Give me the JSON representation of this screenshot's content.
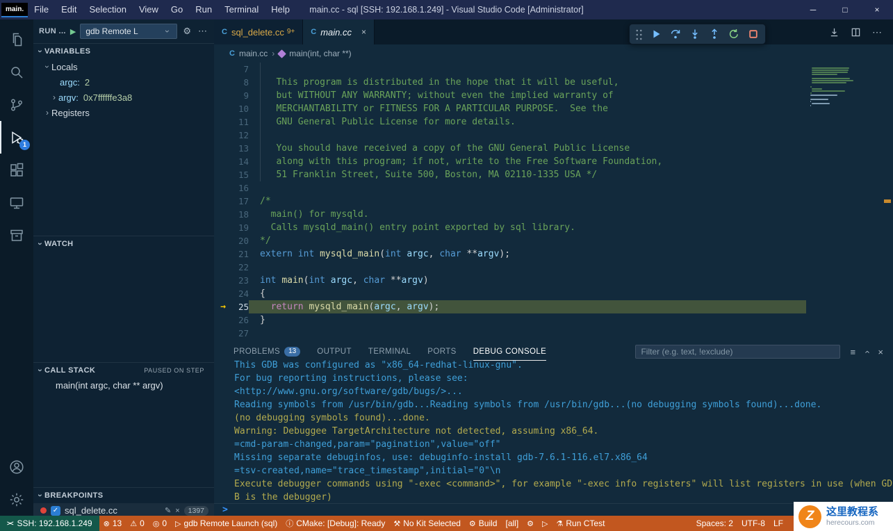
{
  "glyphs": {
    "chevron": "›",
    "close": "×",
    "ellipsis": "⋯",
    "gear": "⚙",
    "play": "▶",
    "edit": "✎",
    "check": "✓",
    "minimize": "─",
    "maximize": "□",
    "window_close": "×",
    "breadcrumb_sep": "›",
    "remote": "><",
    "prompt": ">",
    "ip_arrow": "→",
    "file_c": "C",
    "menu_lines": "≡"
  },
  "title_bar": {
    "app_badge": "main.",
    "menus": [
      "File",
      "Edit",
      "Selection",
      "View",
      "Go",
      "Run",
      "Terminal",
      "Help"
    ],
    "title": "main.cc - sql [SSH: 192.168.1.249] - Visual Studio Code [Administrator]"
  },
  "activity_bar": {
    "debug_badge": "1"
  },
  "sidebar": {
    "run_label": "RUN ...",
    "launch_config": "gdb Remote L",
    "variables": {
      "title": "VARIABLES",
      "scope_label": "Locals",
      "vars": [
        {
          "name": "argc:",
          "value": "2"
        },
        {
          "name": "argv:",
          "value": "0x7ffffffe3a8"
        }
      ],
      "registers_label": "Registers"
    },
    "watch": {
      "title": "WATCH"
    },
    "call_stack": {
      "title": "CALL STACK",
      "status": "PAUSED ON STEP",
      "frame": "main(int argc, char ** argv)"
    },
    "breakpoints": {
      "title": "BREAKPOINTS",
      "file": "sql_delete.cc",
      "line": "1397"
    }
  },
  "editor": {
    "tabs": [
      {
        "label": "sql_delete.cc",
        "badge": "9+"
      },
      {
        "label": "main.cc",
        "badge": ""
      }
    ],
    "breadcrumbs": {
      "file": "main.cc",
      "symbol": "main(int, char **)"
    },
    "current_line": 25,
    "code_lines": [
      {
        "n": 7,
        "tokens": []
      },
      {
        "n": 8,
        "tokens": [
          {
            "t": "   This program is distributed in the hope that it will be useful,",
            "c": "cm"
          }
        ]
      },
      {
        "n": 9,
        "tokens": [
          {
            "t": "   but WITHOUT ANY WARRANTY; without even the implied warranty of",
            "c": "cm"
          }
        ]
      },
      {
        "n": 10,
        "tokens": [
          {
            "t": "   MERCHANTABILITY or FITNESS FOR A PARTICULAR PURPOSE.  See the",
            "c": "cm"
          }
        ]
      },
      {
        "n": 11,
        "tokens": [
          {
            "t": "   GNU General Public License for more details.",
            "c": "cm"
          }
        ]
      },
      {
        "n": 12,
        "tokens": []
      },
      {
        "n": 13,
        "tokens": [
          {
            "t": "   You should have received a copy of the GNU General Public License",
            "c": "cm"
          }
        ]
      },
      {
        "n": 14,
        "tokens": [
          {
            "t": "   along with this program; if not, write to the Free Software Foundation,",
            "c": "cm"
          }
        ]
      },
      {
        "n": 15,
        "tokens": [
          {
            "t": "   51 Franklin Street, Suite 500, Boston, MA 02110-1335 USA */",
            "c": "cm"
          }
        ]
      },
      {
        "n": 16,
        "tokens": []
      },
      {
        "n": 17,
        "tokens": [
          {
            "t": "/*",
            "c": "cm"
          }
        ]
      },
      {
        "n": 18,
        "tokens": [
          {
            "t": "  main() for mysqld.",
            "c": "cm"
          }
        ]
      },
      {
        "n": 19,
        "tokens": [
          {
            "t": "  Calls mysqld_main() entry point exported by sql library.",
            "c": "cm"
          }
        ]
      },
      {
        "n": 20,
        "tokens": [
          {
            "t": "*/",
            "c": "cm"
          }
        ]
      },
      {
        "n": 21,
        "tokens": [
          {
            "t": "extern",
            "c": "kw"
          },
          {
            "t": " ",
            "c": "pl"
          },
          {
            "t": "int",
            "c": "kw"
          },
          {
            "t": " ",
            "c": "pl"
          },
          {
            "t": "mysqld_main",
            "c": "fn"
          },
          {
            "t": "(",
            "c": "pl"
          },
          {
            "t": "int",
            "c": "kw"
          },
          {
            "t": " ",
            "c": "pl"
          },
          {
            "t": "argc",
            "c": "vr"
          },
          {
            "t": ", ",
            "c": "pl"
          },
          {
            "t": "char",
            "c": "kw"
          },
          {
            "t": " **",
            "c": "pl"
          },
          {
            "t": "argv",
            "c": "vr"
          },
          {
            "t": ");",
            "c": "pl"
          }
        ]
      },
      {
        "n": 22,
        "tokens": []
      },
      {
        "n": 23,
        "tokens": [
          {
            "t": "int",
            "c": "kw"
          },
          {
            "t": " ",
            "c": "pl"
          },
          {
            "t": "main",
            "c": "fn"
          },
          {
            "t": "(",
            "c": "pl"
          },
          {
            "t": "int",
            "c": "kw"
          },
          {
            "t": " ",
            "c": "pl"
          },
          {
            "t": "argc",
            "c": "vr"
          },
          {
            "t": ", ",
            "c": "pl"
          },
          {
            "t": "char",
            "c": "kw"
          },
          {
            "t": " **",
            "c": "pl"
          },
          {
            "t": "argv",
            "c": "vr"
          },
          {
            "t": ")",
            "c": "pl"
          }
        ]
      },
      {
        "n": 24,
        "tokens": [
          {
            "t": "{",
            "c": "pl"
          }
        ]
      },
      {
        "n": 25,
        "tokens": [
          {
            "t": "  ",
            "c": "pl"
          },
          {
            "t": "return",
            "c": "ctl"
          },
          {
            "t": " ",
            "c": "pl"
          },
          {
            "t": "mysqld_main",
            "c": "fn"
          },
          {
            "t": "(",
            "c": "pl"
          },
          {
            "t": "argc",
            "c": "vr"
          },
          {
            "t": ", ",
            "c": "pl"
          },
          {
            "t": "argv",
            "c": "vr"
          },
          {
            "t": ");",
            "c": "pl"
          }
        ]
      },
      {
        "n": 26,
        "tokens": [
          {
            "t": "}",
            "c": "pl"
          }
        ]
      },
      {
        "n": 27,
        "tokens": []
      }
    ]
  },
  "panel": {
    "tabs": [
      {
        "label": "PROBLEMS",
        "badge": "13",
        "active": false
      },
      {
        "label": "OUTPUT",
        "badge": "",
        "active": false
      },
      {
        "label": "TERMINAL",
        "badge": "",
        "active": false
      },
      {
        "label": "PORTS",
        "badge": "",
        "active": false
      },
      {
        "label": "DEBUG CONSOLE",
        "badge": "",
        "active": true
      }
    ],
    "filter_placeholder": "Filter (e.g. text, !exclude)",
    "console_lines": [
      {
        "text": "This GDB was configured as \"x86_64-redhat-linux-gnu\".",
        "c": "blue"
      },
      {
        "text": "For bug reporting instructions, please see:",
        "c": "blue"
      },
      {
        "text": "<http://www.gnu.org/software/gdb/bugs/>...",
        "c": "blue"
      },
      {
        "text": "Reading symbols from /usr/bin/gdb...Reading symbols from /usr/bin/gdb...(no debugging symbols found)...done.",
        "c": "blue"
      },
      {
        "text": "(no debugging symbols found)...done.",
        "c": "yellow"
      },
      {
        "text": "Warning: Debuggee TargetArchitecture not detected, assuming x86_64.",
        "c": "yellow"
      },
      {
        "text": "=cmd-param-changed,param=\"pagination\",value=\"off\"",
        "c": "blue"
      },
      {
        "text": "Missing separate debuginfos, use: debuginfo-install gdb-7.6.1-116.el7.x86_64",
        "c": "blue"
      },
      {
        "text": "=tsv-created,name=\"trace_timestamp\",initial=\"0\"\\n",
        "c": "blue"
      },
      {
        "text": "Execute debugger commands using \"-exec <command>\", for example \"-exec info registers\" will list registers in use (when GD",
        "c": "yellow"
      },
      {
        "text": "B is the debugger)",
        "c": "yellow"
      }
    ]
  },
  "status_bar": {
    "remote_label": "SSH: 192.168.1.249",
    "items_left": [
      {
        "name": "errors",
        "glyph": "⊗",
        "label": "13"
      },
      {
        "name": "warnings",
        "glyph": "⚠",
        "label": "0"
      },
      {
        "name": "ports",
        "glyph": "◎",
        "label": "0"
      },
      {
        "name": "debug-target",
        "glyph": "▷",
        "label": "gdb Remote Launch (sql)"
      },
      {
        "name": "cmake-status",
        "glyph": "ⓘ",
        "label": "CMake: [Debug]: Ready"
      },
      {
        "name": "cmake-kit",
        "glyph": "⚒",
        "label": "No Kit Selected"
      },
      {
        "name": "cmake-build",
        "glyph": "⚙",
        "label": "Build"
      },
      {
        "name": "build-target",
        "glyph": "",
        "label": "[all]"
      },
      {
        "name": "cmake-settings",
        "glyph": "⚙",
        "label": ""
      },
      {
        "name": "cmake-launch",
        "glyph": "▷",
        "label": ""
      },
      {
        "name": "run-ctest",
        "glyph": "⚗",
        "label": "Run CTest"
      }
    ],
    "items_right": [
      {
        "name": "indentation",
        "label": "Spaces: 2"
      },
      {
        "name": "encoding",
        "label": "UTF-8"
      },
      {
        "name": "eol",
        "label": "LF"
      }
    ]
  },
  "watermark": {
    "logo_letter": "Z",
    "line1": "这里教程系",
    "line2": "herecours.com"
  }
}
